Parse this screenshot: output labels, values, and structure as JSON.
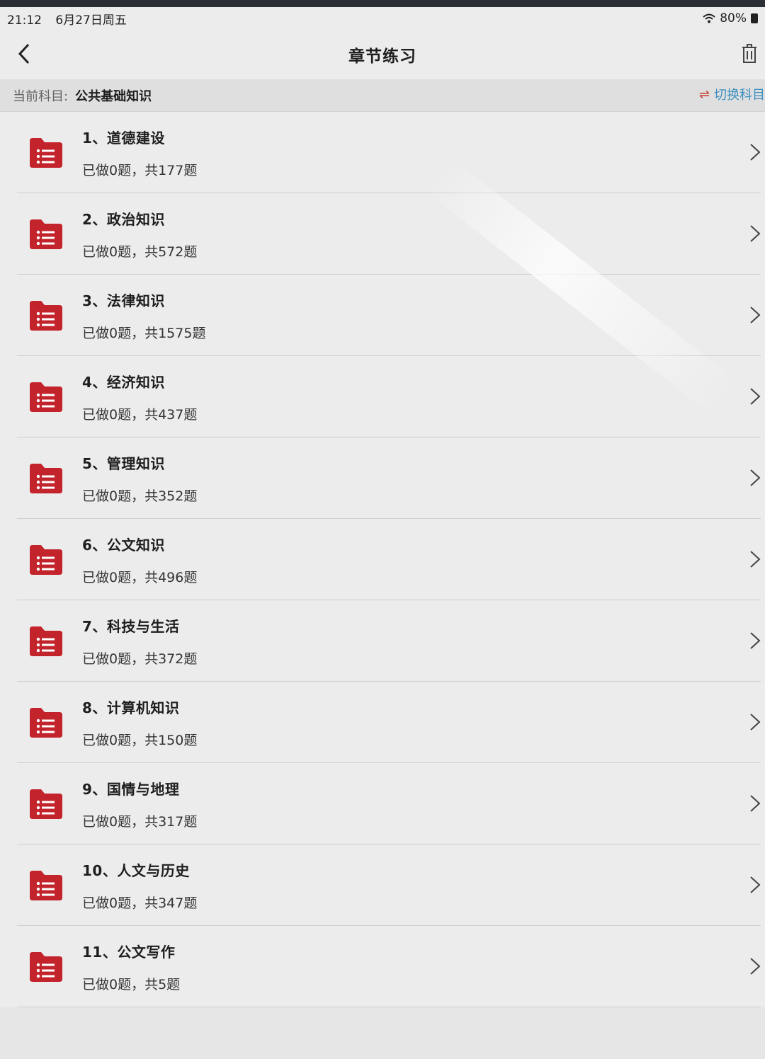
{
  "status": {
    "time": "21:12",
    "date": "6月27日周五",
    "battery": "80%"
  },
  "nav": {
    "title": "章节练习"
  },
  "subject": {
    "label": "当前科目:",
    "name": "公共基础知识",
    "switch_label": "切换科目"
  },
  "colors": {
    "accent_red": "#c3232b",
    "link_blue": "#3d8fbf"
  },
  "chapters": [
    {
      "title": "1、道德建设",
      "progress": "已做0题，共177题"
    },
    {
      "title": "2、政治知识",
      "progress": "已做0题，共572题"
    },
    {
      "title": "3、法律知识",
      "progress": "已做0题，共1575题"
    },
    {
      "title": "4、经济知识",
      "progress": "已做0题，共437题"
    },
    {
      "title": "5、管理知识",
      "progress": "已做0题，共352题"
    },
    {
      "title": "6、公文知识",
      "progress": "已做0题，共496题"
    },
    {
      "title": "7、科技与生活",
      "progress": "已做0题，共372题"
    },
    {
      "title": "8、计算机知识",
      "progress": "已做0题，共150题"
    },
    {
      "title": "9、国情与地理",
      "progress": "已做0题，共317题"
    },
    {
      "title": "10、人文与历史",
      "progress": "已做0题，共347题"
    },
    {
      "title": "11、公文写作",
      "progress": "已做0题，共5题"
    }
  ]
}
